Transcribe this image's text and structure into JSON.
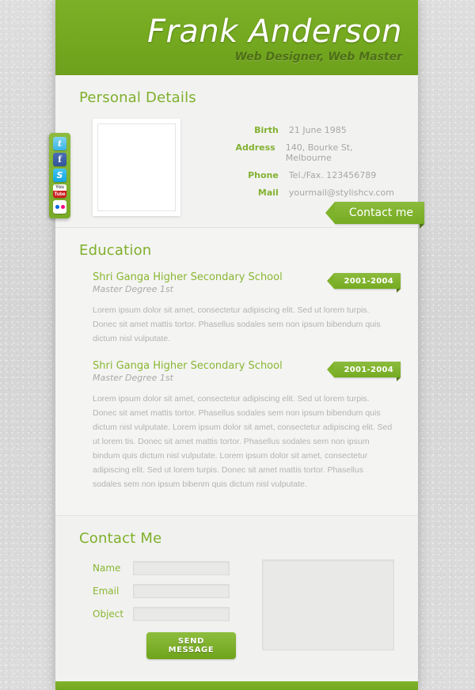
{
  "header": {
    "name": "Frank Anderson",
    "role": "Web Designer, Web Master"
  },
  "social": {
    "items": [
      {
        "name": "twitter",
        "label": "t"
      },
      {
        "name": "facebook",
        "label": "f"
      },
      {
        "name": "skype",
        "label": "S"
      },
      {
        "name": "youtube",
        "label_top": "You",
        "label_bottom": "Tube"
      },
      {
        "name": "flickr",
        "label": ""
      }
    ]
  },
  "personal": {
    "title": "Personal Details",
    "fields": [
      {
        "label": "Birth",
        "value": "21 June 1985"
      },
      {
        "label": "Address",
        "value": "140, Bourke St, Melbourne"
      },
      {
        "label": "Phone",
        "value": "Tel./Fax. 123456789"
      },
      {
        "label": "Mail",
        "value": "yourmail@stylishcv.com"
      }
    ],
    "contact_button": "Contact me"
  },
  "education": {
    "title": "Education",
    "items": [
      {
        "school": "Shri Ganga Higher Secondary School",
        "degree": "Master Degree 1st",
        "period": "2001-2004",
        "text": "Lorem ipsum dolor sit amet, consectetur adipiscing elit. Sed ut lorem turpis. Donec sit amet mattis tortor. Phasellus sodales sem non ipsum bibendum quis dictum nisl vulputate."
      },
      {
        "school": "Shri Ganga Higher Secondary School",
        "degree": "Master Degree 1st",
        "period": "2001-2004",
        "text": "Lorem ipsum dolor sit amet, consectetur adipiscing elit. Sed ut lorem turpis. Donec sit amet mattis tortor. Phasellus sodales sem non ipsum bibendum quis dictum nisl vulputate. Lorem ipsum dolor sit amet, consectetur adipiscing elit. Sed ut lorem tis. Donec sit amet mattis tortor. Phasellus sodales sem non ipsum bindum quis dictum nisl vulputate. Lorem ipsum dolor sit amet, consectetur adipiscing elit. Sed ut lorem turpis. Donec sit amet mattis tortor. Phasellus sodales sem non ipsum bibenm quis dictum nisl vulputate."
      }
    ]
  },
  "contact": {
    "title": "Contact Me",
    "fields": [
      {
        "label": "Name",
        "value": "",
        "placeholder": ""
      },
      {
        "label": "Email",
        "value": "",
        "placeholder": ""
      },
      {
        "label": "Object",
        "value": "",
        "placeholder": ""
      }
    ],
    "message": {
      "value": "",
      "placeholder": ""
    },
    "send_label": "SEND MESSAGE"
  },
  "colors": {
    "green": "#7fb22b",
    "green_dark": "#6ea01d",
    "green_text": "#8ab732",
    "body_text": "#b3b3b1",
    "page_bg": "#f2f2f1"
  }
}
